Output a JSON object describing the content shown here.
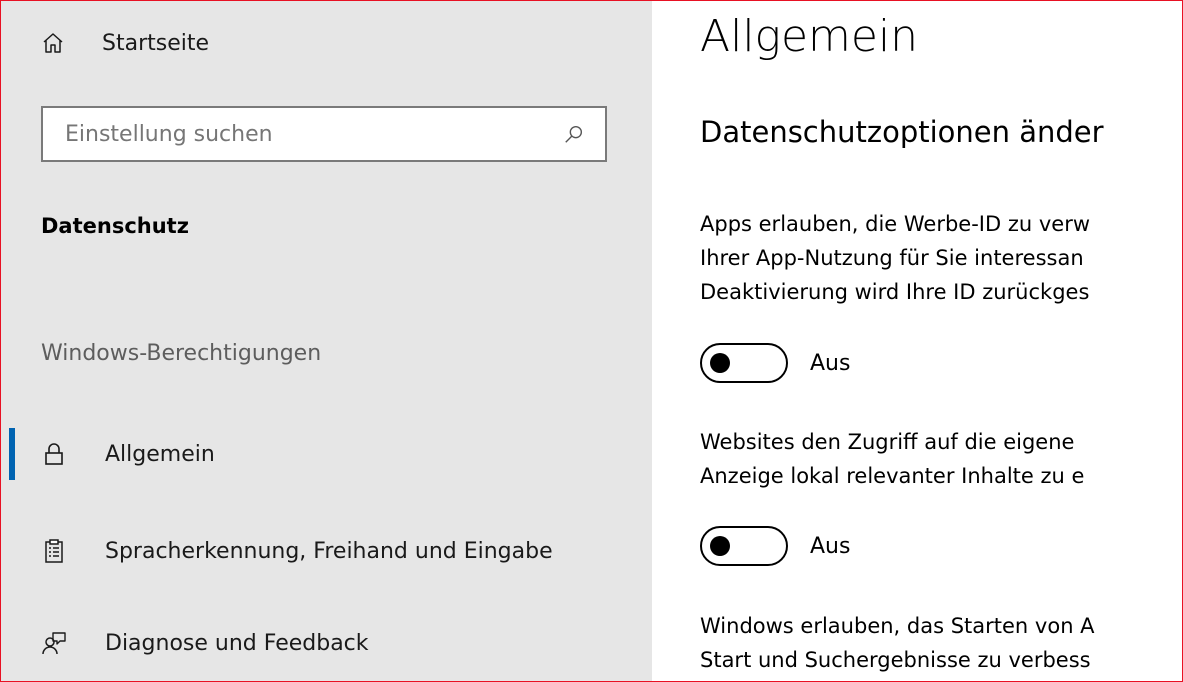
{
  "sidebar": {
    "home_label": "Startseite",
    "search_placeholder": "Einstellung suchen",
    "section_title": "Datenschutz",
    "group_title": "Windows-Berechtigungen",
    "items": [
      {
        "label": "Allgemein",
        "icon": "lock-icon",
        "active": true
      },
      {
        "label": "Spracherkennung, Freihand und Eingabe",
        "icon": "clipboard-icon",
        "active": false
      },
      {
        "label": "Diagnose und Feedback",
        "icon": "person-feedback-icon",
        "active": false
      }
    ]
  },
  "main": {
    "title": "Allgemein",
    "subtitle": "Datenschutzoptionen änder",
    "settings": [
      {
        "lines": [
          "Apps erlauben, die Werbe-ID zu verw",
          "Ihrer App-Nutzung für Sie interessan",
          "Deaktivierung wird Ihre ID zurückges"
        ],
        "toggle_state": "Aus"
      },
      {
        "lines": [
          "Websites den Zugriff auf die eigene",
          "Anzeige lokal relevanter Inhalte zu e"
        ],
        "toggle_state": "Aus"
      },
      {
        "lines": [
          "Windows erlauben, das Starten von A",
          "Start und Suchergebnisse zu verbess"
        ]
      }
    ]
  },
  "colors": {
    "sidebar_bg": "#e6e6e6",
    "accent": "#0063b1",
    "frame_border": "#e81123"
  }
}
